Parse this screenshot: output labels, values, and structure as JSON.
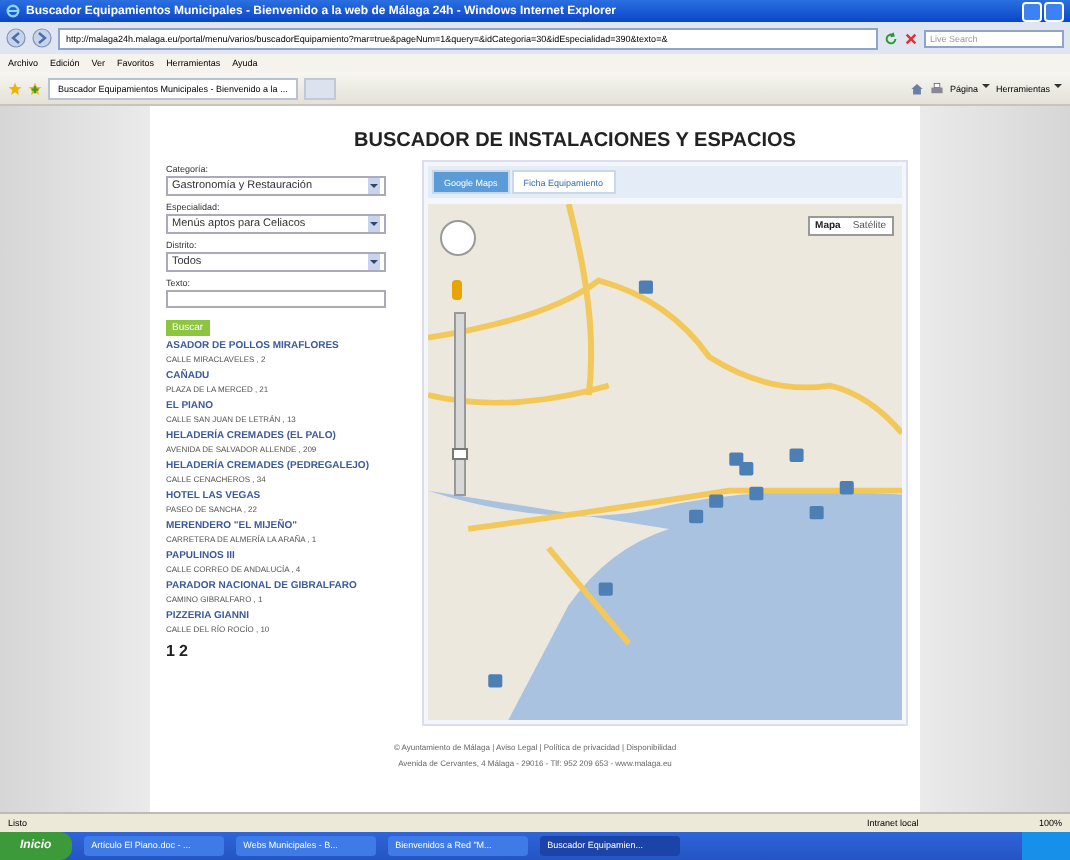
{
  "window": {
    "title": "Buscador Equipamientos Municipales - Bienvenido a la web de Málaga 24h - Windows Internet Explorer"
  },
  "address_bar": {
    "url": "http://malaga24h.malaga.eu/portal/menu/varios/buscadorEquipamiento?mar=true&pageNum=1&query=&idCategoria=30&idEspecialidad=390&texto=&"
  },
  "search": {
    "placeholder": "Live Search"
  },
  "menu": [
    "Archivo",
    "Edición",
    "Ver",
    "Favoritos",
    "Herramientas",
    "Ayuda"
  ],
  "browser_tab": {
    "title": "Buscador Equipamientos Municipales - Bienvenido a la ..."
  },
  "command_bar": [
    "Página",
    "Herramientas"
  ],
  "page": {
    "heading": "BUSCADOR DE INSTALACIONES Y ESPACIOS",
    "fields": [
      {
        "kind": "select",
        "label": "Categoría:",
        "value": "Gastronomía y Restauración"
      },
      {
        "kind": "select",
        "label": "Especialidad:",
        "value": "Menús aptos para Celiacos"
      },
      {
        "kind": "select",
        "label": "Distrito:",
        "value": "Todos"
      },
      {
        "kind": "text",
        "label": "Texto:"
      }
    ],
    "map_zoom": {
      "level": 0.2
    },
    "search_button": "Buscar",
    "results": [
      {
        "name": "ASADOR DE POLLOS MIRAFLORES",
        "address": "CALLE MIRACLAVELES , 2"
      },
      {
        "name": "CAÑADU",
        "address": "PLAZA DE LA MERCED , 21"
      },
      {
        "name": "EL PIANO",
        "address": "CALLE SAN JUAN DE LETRÁN , 13"
      },
      {
        "name": "HELADERÍA CREMADES (EL PALO)",
        "address": "AVENIDA DE SALVADOR ALLENDE , 209"
      },
      {
        "name": "HELADERÍA CREMADES (PEDREGALEJO)",
        "address": "CALLE CENACHEROS , 34"
      },
      {
        "name": "HOTEL LAS VEGAS",
        "address": "PASEO DE SANCHA , 22"
      },
      {
        "name": "MERENDERO \"EL MIJEÑO\"",
        "address": "CARRETERA DE ALMERÍA LA ARAÑA , 1"
      },
      {
        "name": "PAPULINOS III",
        "address": "CALLE CORREO DE ANDALUCÍA , 4"
      },
      {
        "name": "PARADOR NACIONAL DE GIBRALFARO",
        "address": "CAMINO GIBRALFARO , 1"
      },
      {
        "name": "PIZZERIA GIANNI",
        "address": "CALLE DEL RÍO ROCÍO , 10"
      }
    ],
    "pages": [
      "1",
      "2"
    ],
    "map_tabs": [
      {
        "label": "Google Maps",
        "selected": true
      },
      {
        "label": "Ficha Equipamiento",
        "selected": false
      }
    ],
    "map_types": [
      {
        "label": "Mapa",
        "selected": true
      },
      {
        "label": "Satélite",
        "selected": false
      }
    ],
    "footer": [
      "© Ayuntamiento de Málaga | Aviso Legal | Política de privacidad | Disponibilidad",
      "Avenida de Cervantes, 4 Málaga - 29016 - Tlf: 952 209 653 - www.malaga.eu"
    ]
  },
  "status_bar": {
    "text": "Listo",
    "zone": "Intranet local",
    "zoom": "100%"
  },
  "taskbar": {
    "start": "Inicio",
    "tasks": [
      {
        "label": "Artículo El Piano.doc - ...",
        "selected": false
      },
      {
        "label": "Webs Municipales - B...",
        "selected": false
      },
      {
        "label": "Bienvenidos a Red \"M...",
        "selected": false
      },
      {
        "label": "Buscador Equipamien...",
        "selected": true
      }
    ]
  }
}
